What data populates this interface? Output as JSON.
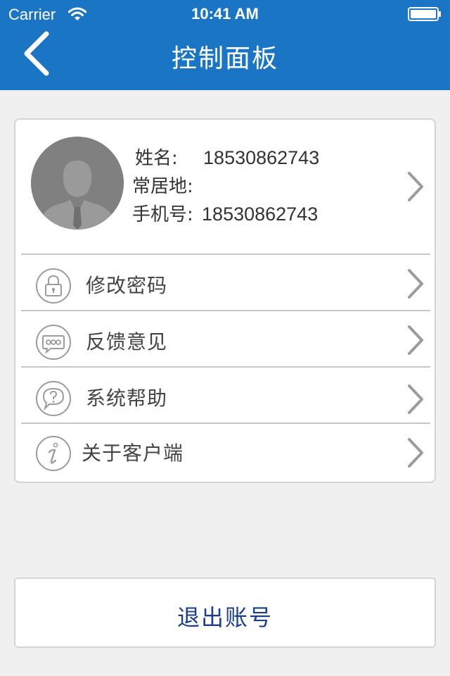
{
  "status_bar": {
    "carrier": "Carrier",
    "time": "10:41 AM",
    "wifi_icon": "wifi-icon",
    "battery_icon": "battery-icon"
  },
  "nav": {
    "title": "控制面板",
    "back_icon": "chevron-left-icon",
    "background_color": "#1a76c4"
  },
  "profile": {
    "avatar_icon": "user-avatar-icon",
    "name_label": "姓名:",
    "name_value": "18530862743",
    "residence_label": "常居地:",
    "residence_value": "",
    "phone_label": "手机号:",
    "phone_value": "18530862743"
  },
  "menu": {
    "items": [
      {
        "label": "修改密码",
        "icon": "lock-icon"
      },
      {
        "label": "反馈意见",
        "icon": "chat-bubble-icon"
      },
      {
        "label": "系统帮助",
        "icon": "help-bubble-icon"
      },
      {
        "label": "关于客户端",
        "icon": "info-icon"
      }
    ]
  },
  "logout": {
    "label": "退出账号",
    "color": "#1c3f8c"
  }
}
